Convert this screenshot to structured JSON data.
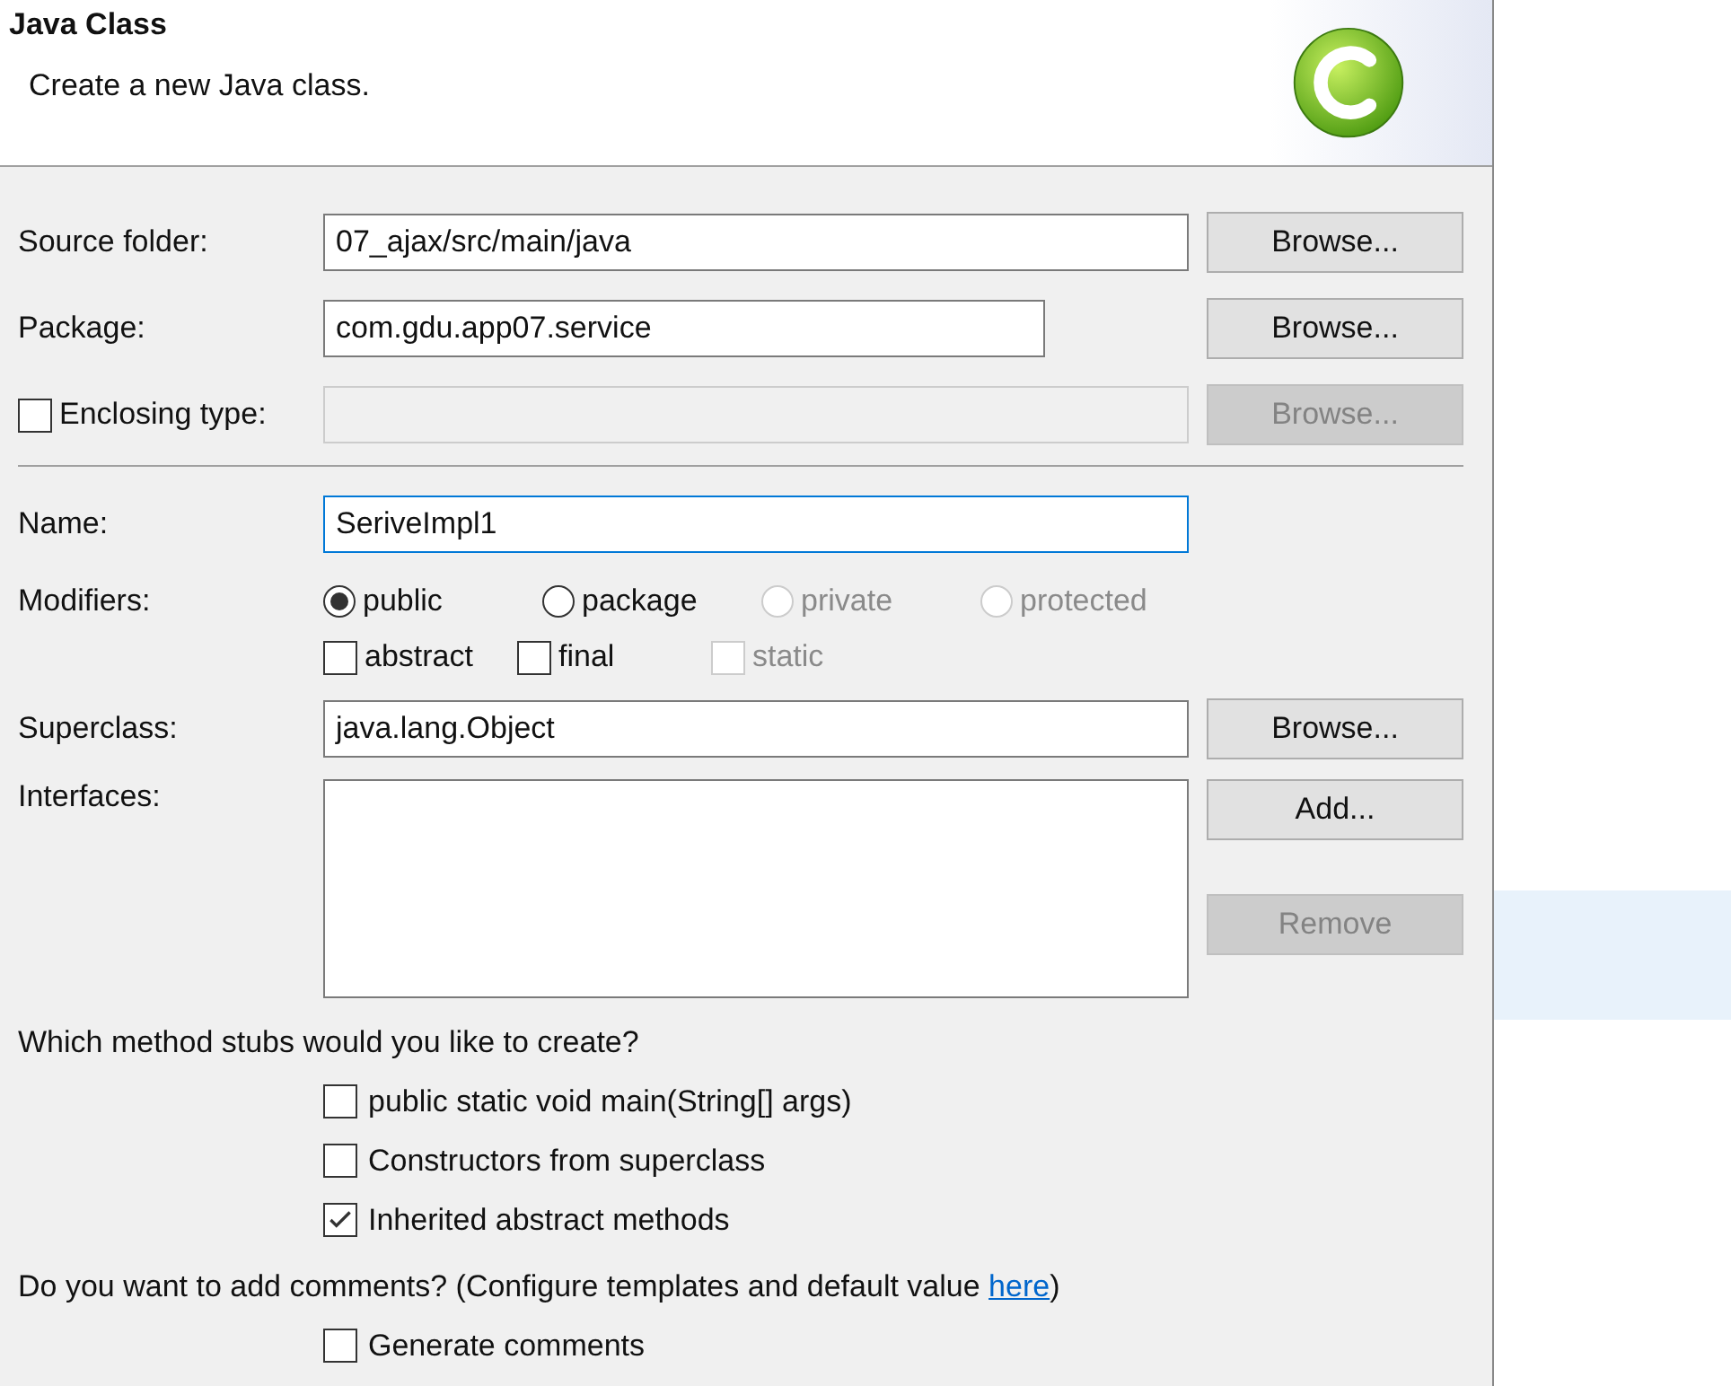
{
  "header": {
    "title": "Java Class",
    "description": "Create a new Java class."
  },
  "source_folder": {
    "label": "Source folder:",
    "value": "07_ajax/src/main/java",
    "button": {
      "label": "Browse...",
      "disabled": false
    }
  },
  "package": {
    "label": "Package:",
    "value": "com.gdu.app07.service",
    "button": {
      "label": "Browse...",
      "disabled": false
    }
  },
  "enclosing_type": {
    "label": "Enclosing type:",
    "checked": false,
    "field_disabled": true,
    "button": {
      "label": "Browse...",
      "disabled": true
    }
  },
  "name": {
    "label": "Name:",
    "value": "SeriveImpl1",
    "focused": true
  },
  "modifiers": {
    "label": "Modifiers:",
    "access": [
      {
        "label": "public",
        "selected": true,
        "disabled": false
      },
      {
        "label": "package",
        "selected": false,
        "disabled": false
      },
      {
        "label": "private",
        "selected": false,
        "disabled": true
      },
      {
        "label": "protected",
        "selected": false,
        "disabled": true
      }
    ],
    "flags": [
      {
        "label": "abstract",
        "checked": false,
        "disabled": false
      },
      {
        "label": "final",
        "checked": false,
        "disabled": false
      },
      {
        "label": "static",
        "checked": false,
        "disabled": true
      }
    ]
  },
  "superclass": {
    "label": "Superclass:",
    "value": "java.lang.Object",
    "button": {
      "label": "Browse...",
      "disabled": false
    }
  },
  "interfaces": {
    "label": "Interfaces:",
    "buttons": [
      {
        "label": "Add...",
        "disabled": false
      },
      {
        "label": "Remove",
        "disabled": true
      }
    ]
  },
  "stubs": {
    "question": "Which method stubs would you like to create?",
    "options": [
      {
        "label": "public static void main(String[] args)",
        "checked": false
      },
      {
        "label": "Constructors from superclass",
        "checked": false
      },
      {
        "label": "Inherited abstract methods",
        "checked": true
      }
    ]
  },
  "comments": {
    "question": "Do you want to add comments? (Configure templates and default value ",
    "link": "here",
    "question_end": ")",
    "options": [
      {
        "label": "Generate comments",
        "checked": false
      }
    ]
  }
}
